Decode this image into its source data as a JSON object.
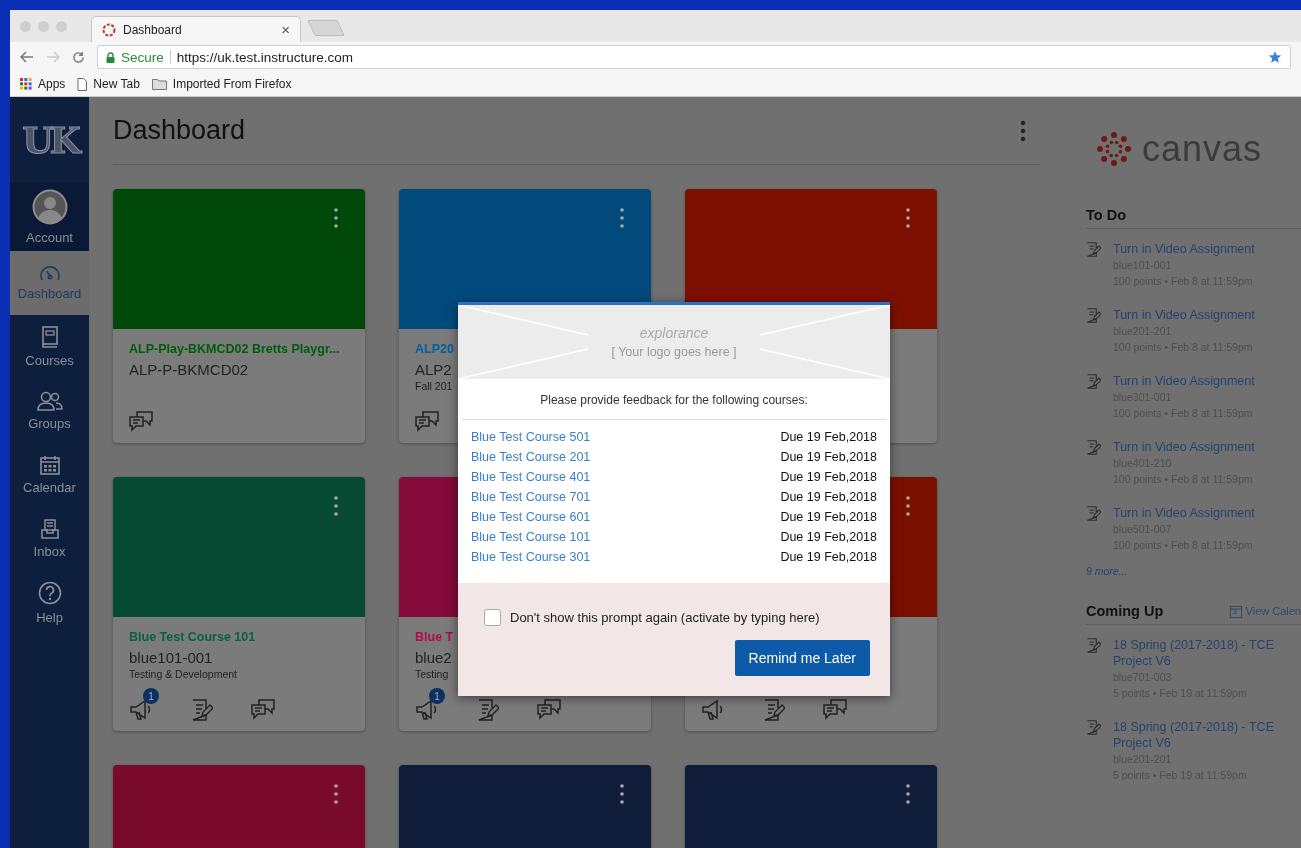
{
  "browser": {
    "tab": {
      "title": "Dashboard",
      "close": "×"
    },
    "secure": "Secure",
    "url": "https://uk.test.instructure.com",
    "bookmarks": [
      {
        "kind": "apps",
        "label": "Apps"
      },
      {
        "kind": "page",
        "label": "New Tab"
      },
      {
        "kind": "folder",
        "label": "Imported From Firefox"
      }
    ]
  },
  "nav": {
    "logo": "UK",
    "items": [
      {
        "kind": "account",
        "label": "Account",
        "selected": false
      },
      {
        "kind": "dashboard",
        "label": "Dashboard",
        "selected": true
      },
      {
        "kind": "courses",
        "label": "Courses",
        "selected": false
      },
      {
        "kind": "groups",
        "label": "Groups",
        "selected": false
      },
      {
        "kind": "calendar",
        "label": "Calendar",
        "selected": false
      },
      {
        "kind": "inbox",
        "label": "Inbox",
        "selected": false
      },
      {
        "kind": "help",
        "label": "Help",
        "selected": false
      }
    ]
  },
  "header": {
    "title": "Dashboard"
  },
  "cards": [
    {
      "color": "#00470a",
      "menu_icon": true,
      "title": "ALP-Play-BKMCD02 Bretts Playgr...",
      "code": "ALP-P-BKMCD02",
      "icons": [
        {
          "kind": "discussions"
        }
      ]
    },
    {
      "color": "#034a7c",
      "menu_icon": true,
      "title": "ALP20",
      "code": "ALP2",
      "term": "Fall 201",
      "icons": [
        {
          "kind": "discussions"
        }
      ]
    },
    {
      "color": "#7d1000",
      "menu_icon": true
    },
    {
      "color": "#064a33",
      "menu_icon": true,
      "title": "Blue Test Course 101",
      "code": "blue101-001",
      "term": "Testing & Development",
      "icons": [
        {
          "kind": "announcements",
          "badge": "1"
        },
        {
          "kind": "assignments"
        },
        {
          "kind": "discussions"
        }
      ]
    },
    {
      "color": "#850b3a",
      "title": "Blue T",
      "code": "blue2",
      "term": "Testing",
      "icons": [
        {
          "kind": "announcements",
          "badge": "1"
        },
        {
          "kind": "assignments"
        },
        {
          "kind": "discussions"
        }
      ]
    },
    {
      "color": "#7a1000",
      "menu_icon": true,
      "icons": [
        {
          "kind": "announcements"
        },
        {
          "kind": "assignments"
        },
        {
          "kind": "discussions"
        }
      ]
    },
    {
      "color": "#7a0a2c",
      "menu_icon": true
    },
    {
      "color": "#0f1d3b",
      "menu_icon": true
    },
    {
      "color": "#0f1d3b",
      "menu_icon": true
    }
  ],
  "sidebar": {
    "brand": "canvas",
    "todo": {
      "title": "To Do",
      "items": [
        {
          "title": "Turn in Video Assignment",
          "course": "blue101-001",
          "details": "100 points • Feb 8 at 11:59pm"
        },
        {
          "title": "Turn in Video Assignment",
          "course": "blue201-201",
          "details": "100 points • Feb 8 at 11:59pm"
        },
        {
          "title": "Turn in Video Assignment",
          "course": "blue301-001",
          "details": "100 points • Feb 8 at 11:59pm"
        },
        {
          "title": "Turn in Video Assignment",
          "course": "blue401-210",
          "details": "100 points • Feb 8 at 11:59pm"
        },
        {
          "title": "Turn in Video Assignment",
          "course": "blue501-007",
          "details": "100 points • Feb 8 at 11:59pm"
        }
      ],
      "more": "9 more..."
    },
    "coming_up": {
      "title": "Coming Up",
      "calendar_link": "View Calen",
      "calendar_day": "3",
      "items": [
        {
          "title": "18 Spring (2017-2018) - TCE Project V6",
          "course": "blue701-003",
          "details": "5 points • Feb 19 at 11:59pm"
        },
        {
          "title": "18 Spring (2017-2018) - TCE Project V6",
          "course": "blue201-201",
          "details": "5 points • Feb 19 at 11:59pm"
        }
      ]
    }
  },
  "modal": {
    "logo_brand": "explorance",
    "logo_placeholder": "[ Your logo goes here ]",
    "heading": "Please provide feedback for the following courses:",
    "courses": [
      {
        "name": "Blue Test Course 501",
        "due": "Due 19 Feb,2018"
      },
      {
        "name": "Blue Test Course 201",
        "due": "Due 19 Feb,2018"
      },
      {
        "name": "Blue Test Course 401",
        "due": "Due 19 Feb,2018"
      },
      {
        "name": "Blue Test Course 701",
        "due": "Due 19 Feb,2018"
      },
      {
        "name": "Blue Test Course 601",
        "due": "Due 19 Feb,2018"
      },
      {
        "name": "Blue Test Course 101",
        "due": "Due 19 Feb,2018"
      },
      {
        "name": "Blue Test Course 301",
        "due": "Due 19 Feb,2018"
      }
    ],
    "dont_show": {
      "label": "Don't show this prompt again (activate by typing here)",
      "checked": false
    },
    "button": "Remind me Later"
  }
}
